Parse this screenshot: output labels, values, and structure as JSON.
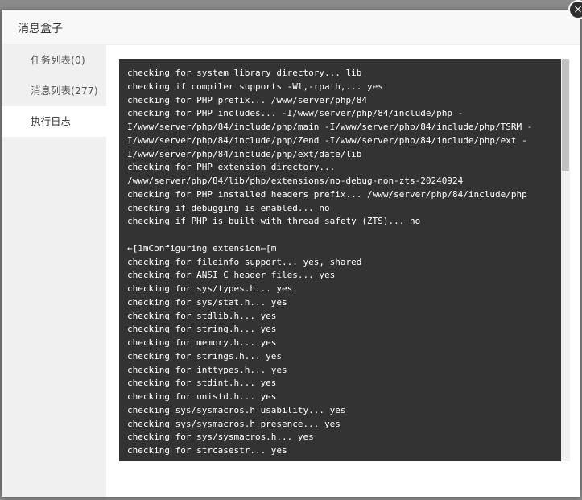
{
  "modal": {
    "title": "消息盒子",
    "close_symbol": "×"
  },
  "sidebar": {
    "items": [
      {
        "label": "任务列表(0)"
      },
      {
        "label": "消息列表(277)"
      },
      {
        "label": "执行日志"
      }
    ]
  },
  "log": {
    "lines": [
      "checking for system library directory... lib",
      "checking if compiler supports -Wl,-rpath,... yes",
      "checking for PHP prefix... /www/server/php/84",
      "checking for PHP includes... -I/www/server/php/84/include/php -",
      "I/www/server/php/84/include/php/main -I/www/server/php/84/include/php/TSRM -",
      "I/www/server/php/84/include/php/Zend -I/www/server/php/84/include/php/ext -",
      "I/www/server/php/84/include/php/ext/date/lib",
      "checking for PHP extension directory...",
      "/www/server/php/84/lib/php/extensions/no-debug-non-zts-20240924",
      "checking for PHP installed headers prefix... /www/server/php/84/include/php",
      "checking if debugging is enabled... no",
      "checking if PHP is built with thread safety (ZTS)... no",
      "",
      "←[1mConfiguring extension←[m",
      "checking for fileinfo support... yes, shared",
      "checking for ANSI C header files... yes",
      "checking for sys/types.h... yes",
      "checking for sys/stat.h... yes",
      "checking for stdlib.h... yes",
      "checking for string.h... yes",
      "checking for memory.h... yes",
      "checking for strings.h... yes",
      "checking for inttypes.h... yes",
      "checking for stdint.h... yes",
      "checking for unistd.h... yes",
      "checking sys/sysmacros.h usability... yes",
      "checking sys/sysmacros.h presence... yes",
      "checking for sys/sysmacros.h... yes",
      "checking for strcasestr... yes"
    ]
  },
  "colors": {
    "log_background": "#333333",
    "sidebar_background": "#f0f0f0",
    "overlay": "#7c7c7c"
  }
}
